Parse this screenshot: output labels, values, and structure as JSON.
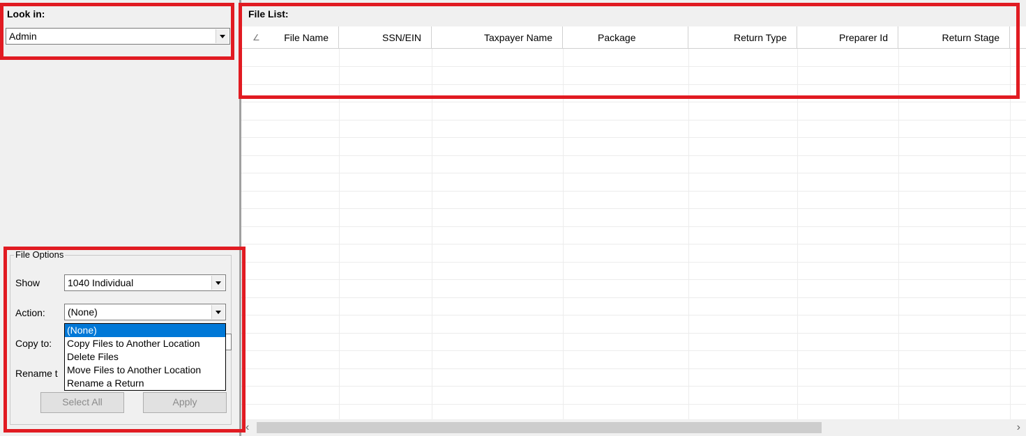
{
  "look_in": {
    "label": "Look in:",
    "value": "Admin"
  },
  "file_list": {
    "title": "File List:",
    "sort_indicator": "∠",
    "columns": [
      "File Name",
      "SSN/EIN",
      "Taxpayer Name",
      "Package",
      "Return Type",
      "Preparer Id",
      "Return Stage"
    ]
  },
  "file_options": {
    "legend": "File Options",
    "show_label": "Show",
    "show_value": "1040 Individual",
    "action_label": "Action:",
    "action_value": "(None)",
    "copy_to_label": "Copy to:",
    "rename_label": "Rename t",
    "dropdown_items": [
      "(None)",
      "Copy Files to Another Location",
      "Delete Files",
      "Move Files to Another Location",
      "Rename a Return"
    ],
    "select_all_label": "Select All",
    "apply_label": "Apply"
  },
  "scroll": {
    "left_arrow": "‹",
    "right_arrow": "›"
  },
  "colors": {
    "highlight_border": "#e11b22",
    "selection": "#0078d7"
  }
}
